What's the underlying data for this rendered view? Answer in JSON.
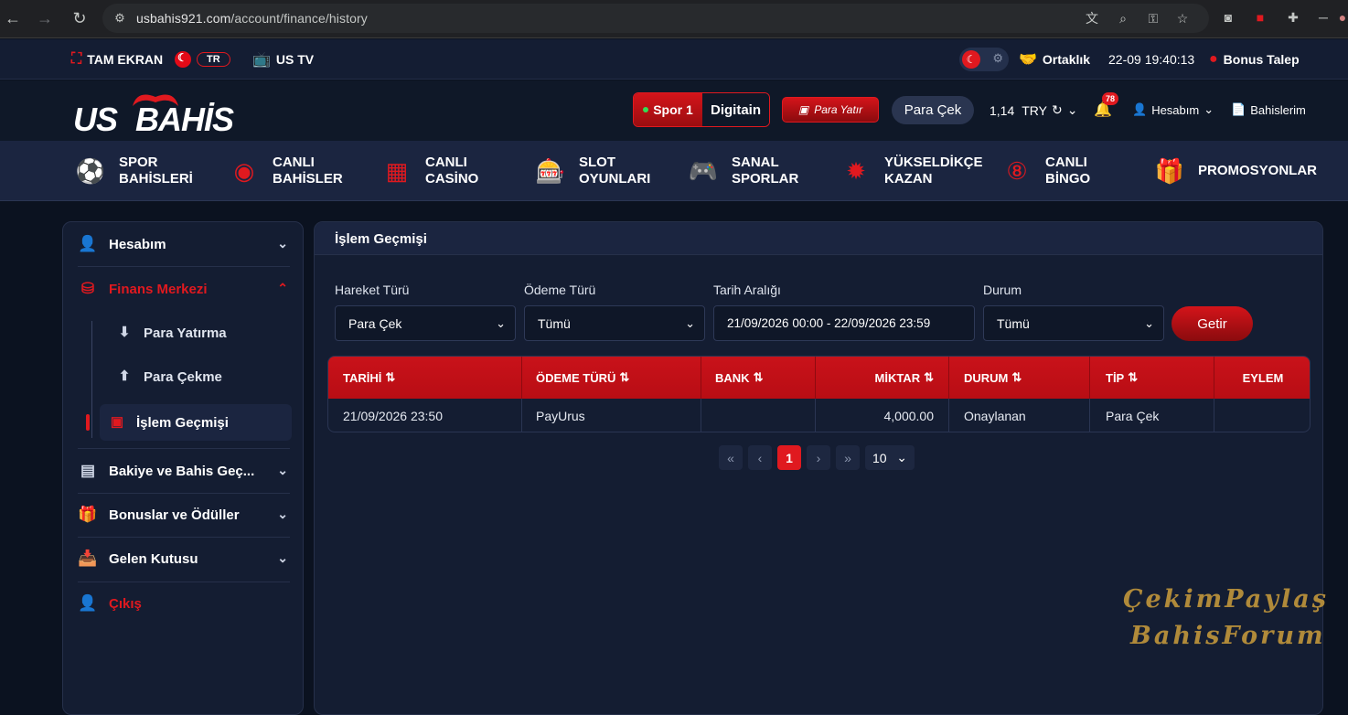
{
  "browser": {
    "url_host": "usbahis921.com",
    "url_path": "/account/finance/history"
  },
  "topbar": {
    "fullscreen": "TAM EKRAN",
    "lang": "TR",
    "tv": "US TV",
    "partner": "Ortaklık",
    "datetime": "22-09  19:40:13",
    "bonus": "Bonus Talep"
  },
  "header": {
    "logo_a": "US",
    "logo_b": "BAHİS",
    "spor": "Spor 1",
    "digitain": "Digitain",
    "para_yatir": "Para Yatır",
    "para_cek": "Para Çek",
    "balance": "1,14",
    "currency": "TRY",
    "notif_count": "78",
    "account": "Hesabım",
    "bets": "Bahislerim"
  },
  "menu": [
    {
      "line1": "SPOR",
      "line2": "BAHİSLERİ",
      "icon": "soccer-ball-icon"
    },
    {
      "line1": "CANLI",
      "line2": "BAHİSLER",
      "icon": "live-ball-icon"
    },
    {
      "line1": "CANLI",
      "line2": "CASİNO",
      "icon": "casino-icon"
    },
    {
      "line1": "SLOT",
      "line2": "OYUNLARI",
      "icon": "slot-machine-icon"
    },
    {
      "line1": "SANAL",
      "line2": "SPORLAR",
      "icon": "gamepad-icon"
    },
    {
      "line1": "YÜKSELDİKÇE",
      "line2": "KAZAN",
      "icon": "rocket-icon"
    },
    {
      "line1": "CANLI",
      "line2": "BİNGO",
      "icon": "bingo-icon"
    },
    {
      "line1": "PROMOSYONLAR",
      "line2": "",
      "icon": "gift-icon"
    }
  ],
  "sidebar": {
    "account": "Hesabım",
    "finance": "Finans Merkezi",
    "deposit": "Para Yatırma",
    "withdraw": "Para Çekme",
    "history": "İşlem Geçmişi",
    "balance_history": "Bakiye ve Bahis Geç...",
    "bonuses": "Bonuslar ve Ödüller",
    "inbox": "Gelen Kutusu",
    "logout": "Çıkış"
  },
  "panel": {
    "title": "İşlem Geçmişi",
    "filters": {
      "movement_label": "Hareket Türü",
      "movement_value": "Para Çek",
      "payment_label": "Ödeme Türü",
      "payment_value": "Tümü",
      "date_label": "Tarih Aralığı",
      "date_value": "21/09/2026 00:00 - 22/09/2026 23:59",
      "status_label": "Durum",
      "status_value": "Tümü",
      "submit": "Getir"
    },
    "table": {
      "headers": [
        "TARİHİ",
        "ÖDEME TÜRÜ",
        "BANK",
        "MİKTAR",
        "DURUM",
        "TİP",
        "EYLEM"
      ],
      "rows": [
        [
          "21/09/2026 23:50",
          "PayUrus",
          "",
          "4,000.00",
          "Onaylanan",
          "Para Çek",
          ""
        ]
      ]
    },
    "pager": {
      "current": "1",
      "page_size": "10"
    }
  },
  "watermark": {
    "line1": "ÇekimPaylaş",
    "line2": "BahisForum"
  },
  "colors": {
    "accent": "#e0191f",
    "background": "#0b1220",
    "panel": "#141d32"
  }
}
